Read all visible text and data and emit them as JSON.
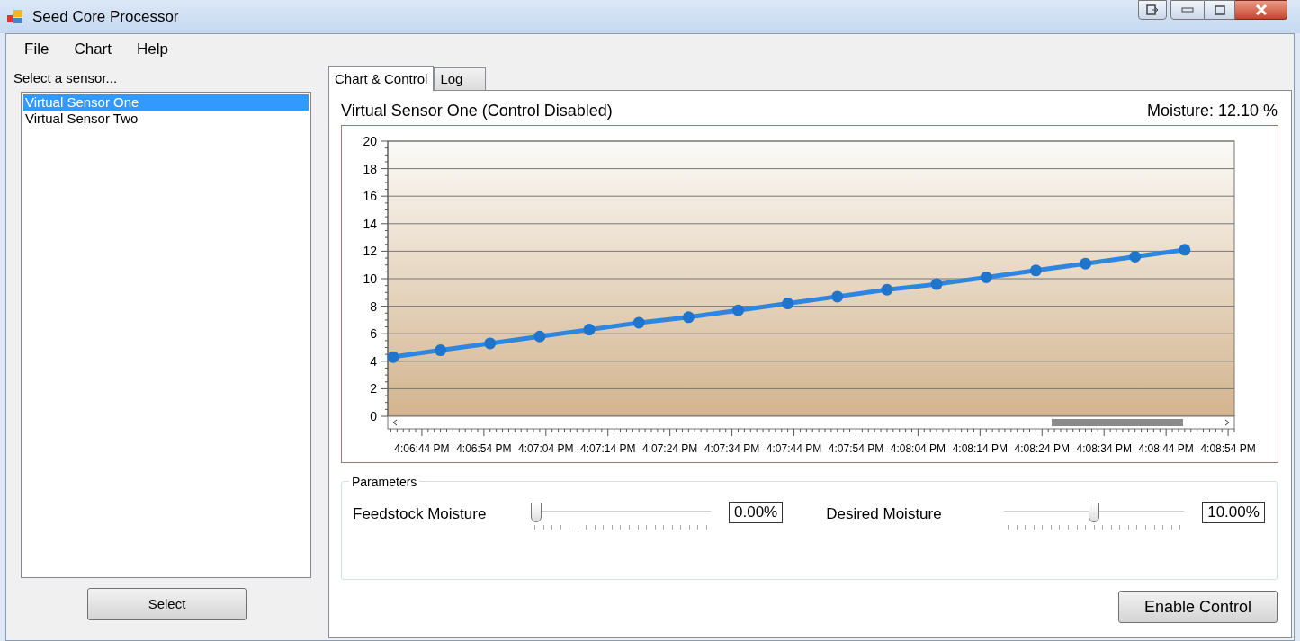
{
  "window": {
    "title": "Seed Core Processor"
  },
  "menu": [
    "File",
    "Chart",
    "Help"
  ],
  "sensor_panel": {
    "label": "Select a sensor...",
    "items": [
      {
        "label": "Virtual Sensor One",
        "selected": true
      },
      {
        "label": "Virtual Sensor Two",
        "selected": false
      }
    ],
    "button": "Select"
  },
  "tabs": [
    {
      "label": "Chart & Control",
      "selected": true
    },
    {
      "label": "Log",
      "selected": false
    }
  ],
  "chart_header": {
    "title": "Virtual Sensor One (Control Disabled)",
    "reading": "Moisture: 12.10 %"
  },
  "chart_data": {
    "type": "line",
    "x": [
      57999,
      58007,
      58015,
      58023,
      58031,
      58039,
      58047,
      58055,
      58063,
      58071,
      58079,
      58087,
      58095,
      58103,
      58111,
      58119,
      58127
    ],
    "grid": true,
    "series": [
      {
        "marker": true,
        "color": "#2f86e0",
        "values": [
          4.3,
          4.8,
          5.3,
          5.8,
          6.3,
          6.8,
          7.2,
          7.7,
          8.2,
          8.7,
          9.2,
          9.6,
          10.1,
          10.6,
          11.1,
          11.6,
          12.1
        ]
      }
    ],
    "xlim": [
      57998.5,
      58135
    ],
    "ylim": [
      0,
      20
    ],
    "yticks": [
      0,
      2,
      4,
      6,
      8,
      10,
      12,
      14,
      16,
      18,
      20
    ],
    "xticks": [
      {
        "value": 58004,
        "label": "4:06:44 PM"
      },
      {
        "value": 58014,
        "label": "4:06:54 PM"
      },
      {
        "value": 58024,
        "label": "4:07:04 PM"
      },
      {
        "value": 58034,
        "label": "4:07:14 PM"
      },
      {
        "value": 58044,
        "label": "4:07:24 PM"
      },
      {
        "value": 58054,
        "label": "4:07:34 PM"
      },
      {
        "value": 58064,
        "label": "4:07:44 PM"
      },
      {
        "value": 58074,
        "label": "4:07:54 PM"
      },
      {
        "value": 58084,
        "label": "4:08:04 PM"
      },
      {
        "value": 58094,
        "label": "4:08:14 PM"
      },
      {
        "value": 58104,
        "label": "4:08:24 PM"
      },
      {
        "value": 58114,
        "label": "4:08:34 PM"
      },
      {
        "value": 58124,
        "label": "4:08:44 PM"
      },
      {
        "value": 58134,
        "label": "4:08:54 PM"
      }
    ]
  },
  "parameters": {
    "title": "Parameters",
    "sliders": [
      {
        "label": "Feedstock Moisture",
        "level": 0,
        "value": "0.00%"
      },
      {
        "label": "Desired Moisture",
        "level": 0.5,
        "value": "10.00%"
      }
    ]
  },
  "enable_button": "Enable Control"
}
